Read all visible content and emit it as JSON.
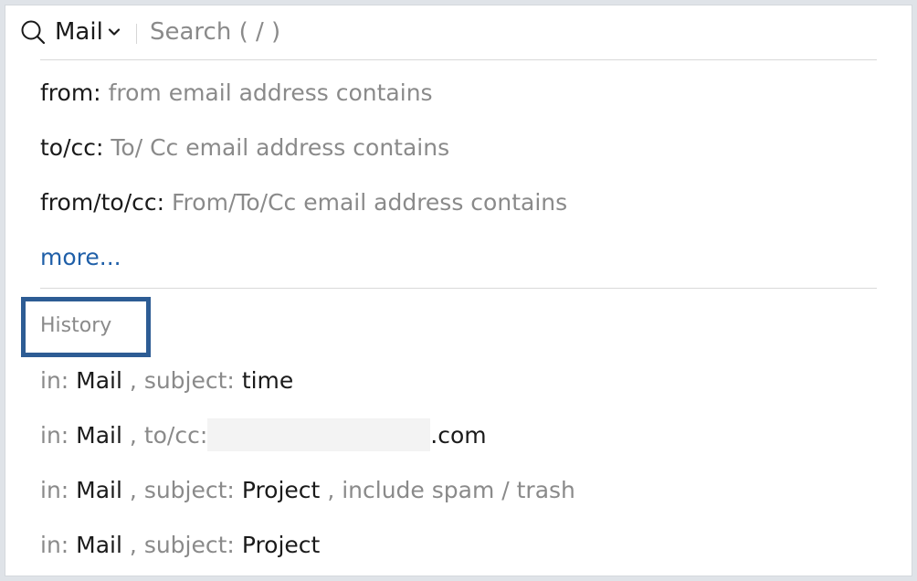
{
  "search": {
    "scope_label": "Mail",
    "placeholder": "Search ( / )",
    "value": ""
  },
  "suggestions": [
    {
      "key": "from:",
      "hint": "from email address contains"
    },
    {
      "key": "to/cc:",
      "hint": "To/ Cc email address contains"
    },
    {
      "key": "from/to/cc:",
      "hint": "From/To/Cc email address contains"
    }
  ],
  "more_label": "more...",
  "history": {
    "label": "History",
    "items": [
      {
        "in_label": "in:",
        "in_value": "Mail",
        "sep": ",",
        "field": "subject:",
        "value": "time"
      },
      {
        "in_label": "in:",
        "in_value": "Mail",
        "sep": ",",
        "field": "to/cc:",
        "value_suffix": ".com"
      },
      {
        "in_label": "in:",
        "in_value": "Mail",
        "sep": ",",
        "field": "subject:",
        "value": "Project",
        "extra": ", include spam / trash"
      },
      {
        "in_label": "in:",
        "in_value": "Mail",
        "sep": ",",
        "field": "subject:",
        "value": "Project"
      }
    ]
  },
  "colors": {
    "accent_link": "#1f5fa8",
    "highlight_box": "#2d5c94",
    "muted_text": "#8a8a8a"
  }
}
